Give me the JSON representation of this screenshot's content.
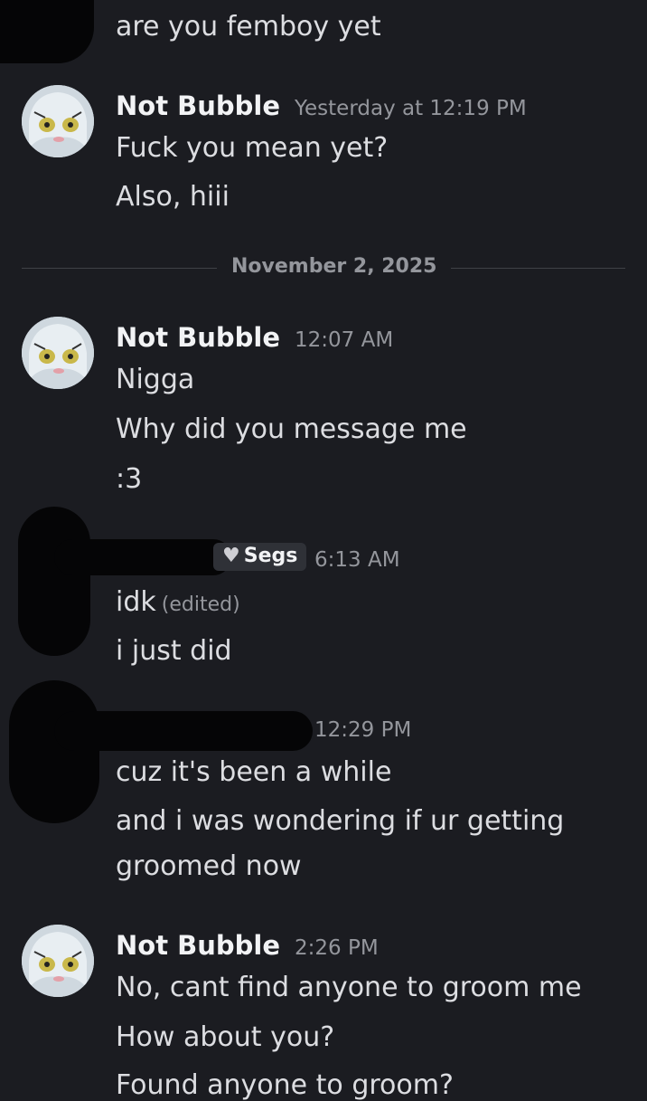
{
  "messages": {
    "m0": {
      "lines": [
        "are you femboy yet"
      ]
    },
    "m1": {
      "username": "Not Bubble",
      "timestamp": "Yesterday at 12:19 PM",
      "lines": [
        "Fuck you mean yet?",
        "Also, hiii"
      ]
    },
    "divider": {
      "label": "November 2, 2025"
    },
    "m2": {
      "username": "Not Bubble",
      "timestamp": "12:07 AM",
      "lines": [
        "Nigga",
        "Why did you message me",
        ":3"
      ]
    },
    "m3": {
      "badge": "Segs",
      "timestamp": "6:13 AM",
      "lines": [
        "idk",
        "i just did"
      ],
      "edited": "(edited)"
    },
    "m4": {
      "timestamp": "12:29 PM",
      "lines": [
        "cuz it's been a while",
        "and i was wondering if ur getting",
        "groomed now"
      ]
    },
    "m5": {
      "username": "Not Bubble",
      "timestamp": "2:26 PM",
      "lines": [
        "No, cant find anyone to groom me",
        "How about you?",
        "Found anyone to groom?"
      ]
    }
  },
  "colors": {
    "background": "#1b1c21",
    "username": "#f2f3f5",
    "muted": "#94969c"
  }
}
